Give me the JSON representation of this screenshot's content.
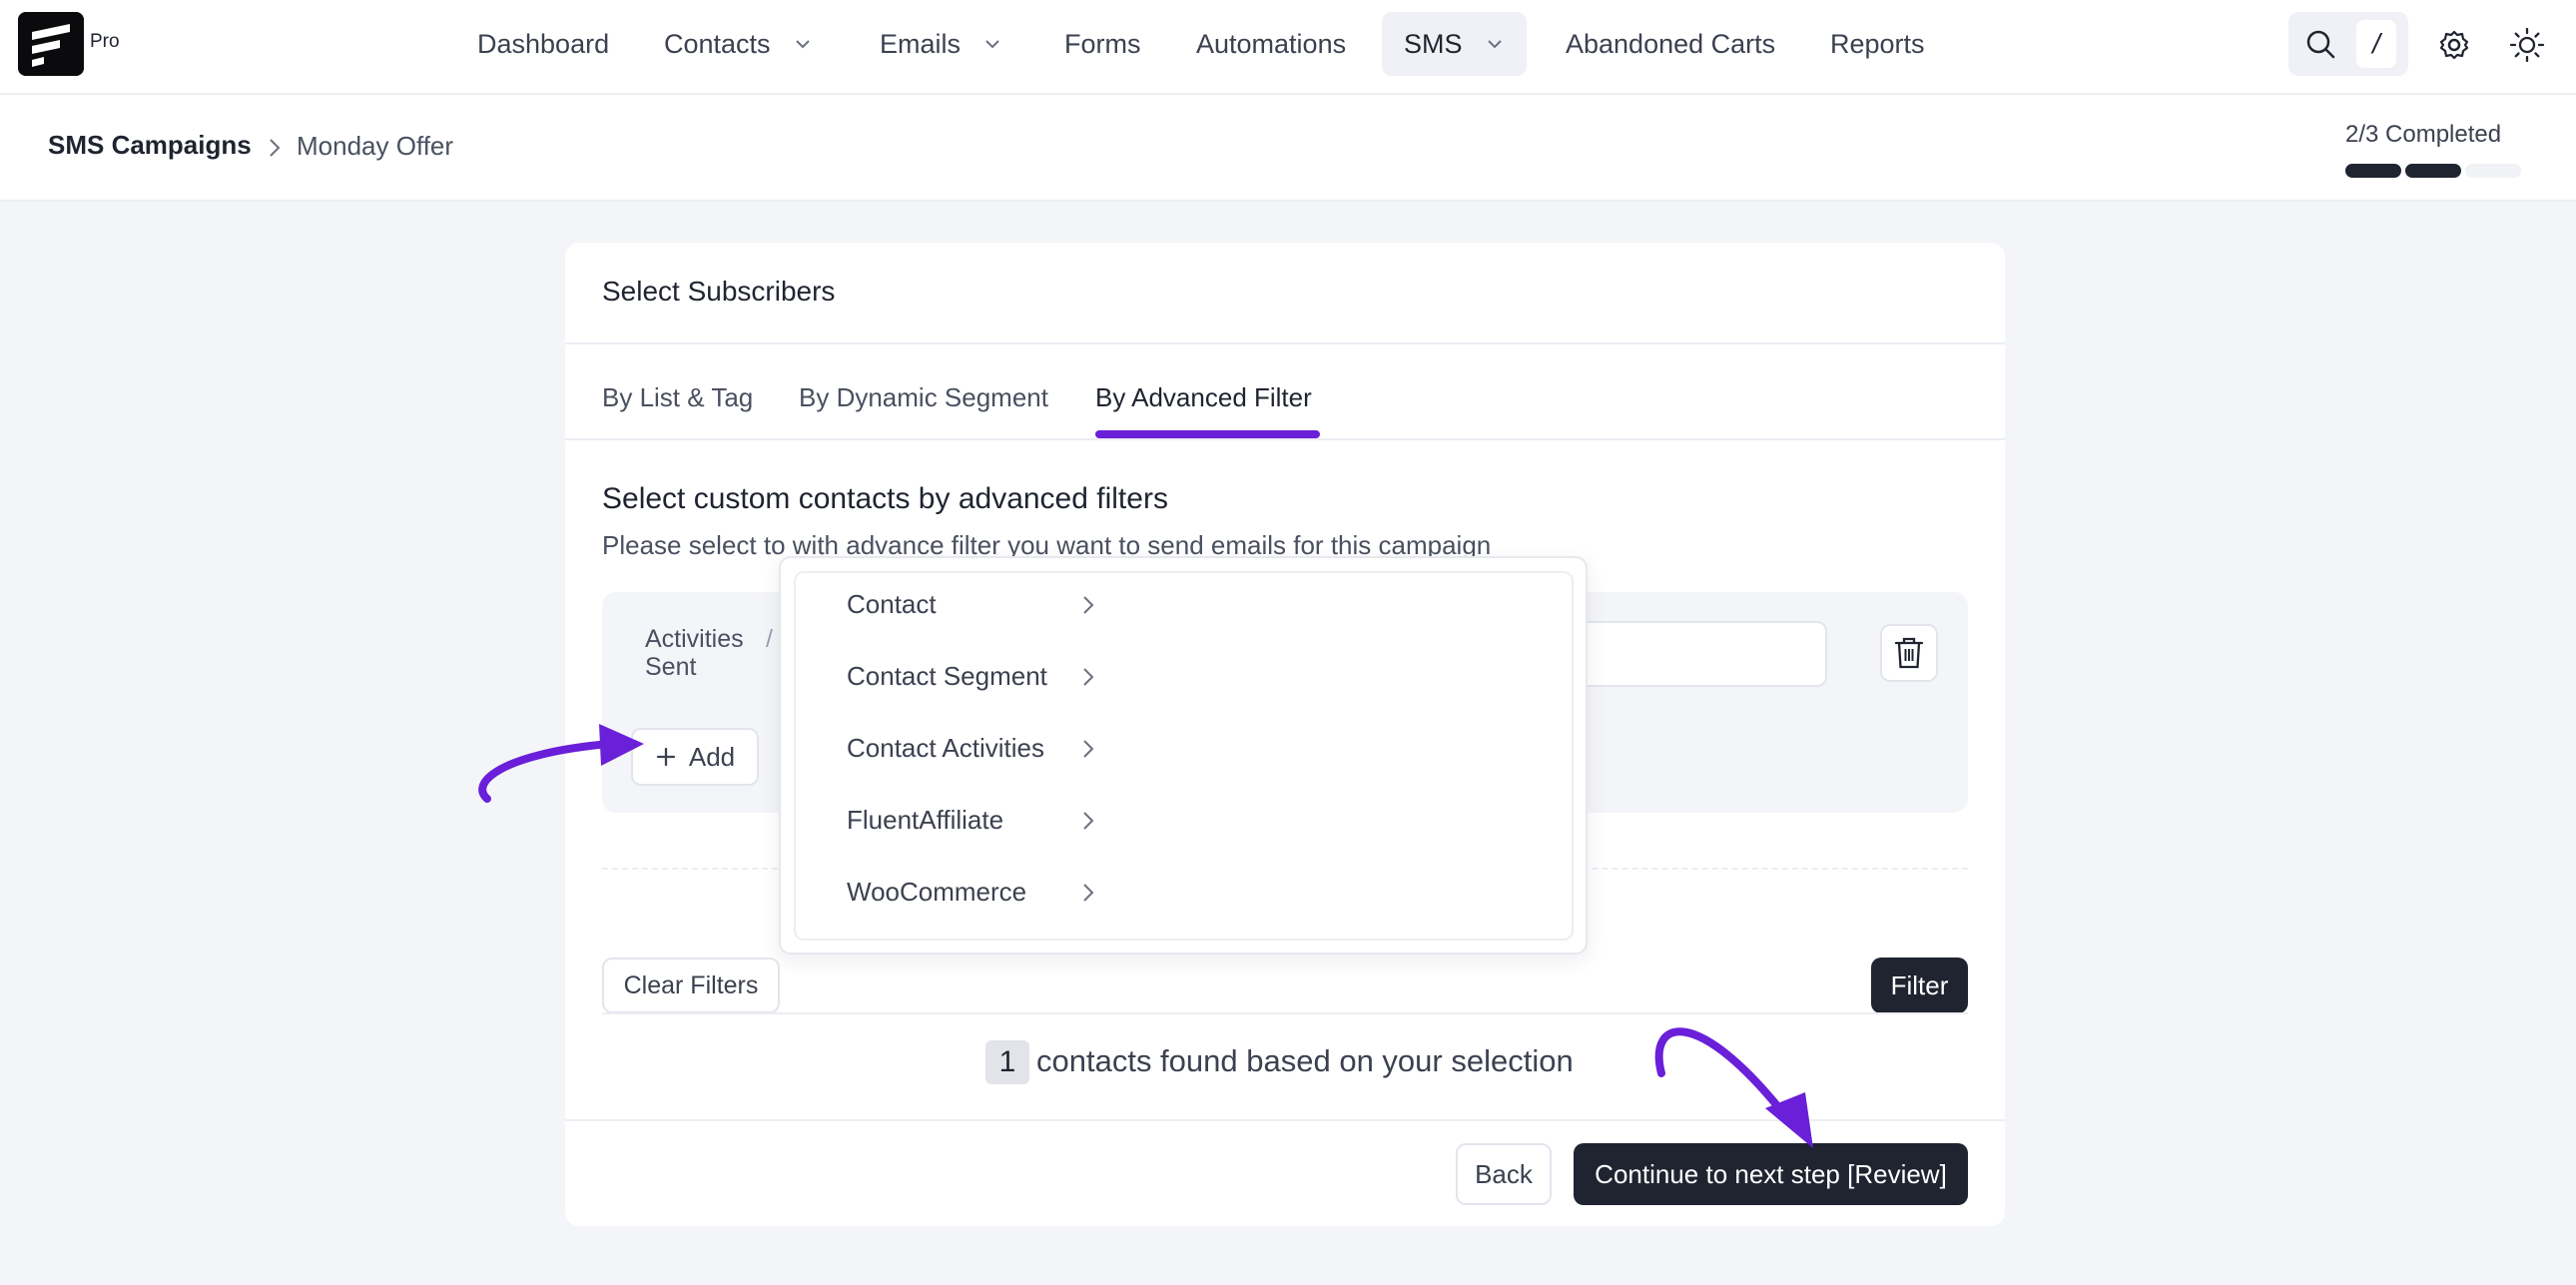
{
  "colors": {
    "accent": "#6a1fd9",
    "dark": "#1f2430",
    "background": "#f4f5f9"
  },
  "brand": {
    "badge": "Pro"
  },
  "nav": {
    "items": [
      {
        "label": "Dashboard"
      },
      {
        "label": "Contacts",
        "has_dropdown": true
      },
      {
        "label": "Emails",
        "has_dropdown": true
      },
      {
        "label": "Forms"
      },
      {
        "label": "Automations"
      },
      {
        "label": "SMS",
        "has_dropdown": true,
        "active": true
      },
      {
        "label": "Abandoned Carts"
      },
      {
        "label": "Reports"
      }
    ],
    "search_shortcut": "/",
    "icons": [
      "search-icon",
      "gear-icon",
      "sun-icon"
    ]
  },
  "breadcrumb": {
    "root": "SMS Campaigns",
    "current": "Monday Offer"
  },
  "progress": {
    "label": "2/3 Completed",
    "completed": 2,
    "total": 3
  },
  "card": {
    "title": "Select Subscribers",
    "tabs": [
      {
        "label": "By List & Tag"
      },
      {
        "label": "By Dynamic Segment"
      },
      {
        "label": "By Advanced Filter",
        "active": true
      }
    ],
    "section_title": "Select custom contacts by advanced filters",
    "section_desc": "Please select to with advance filter you want to send emails for this campaign",
    "filter_row": {
      "label_line1": "Activities",
      "label_line2": "Sent",
      "separator": "/"
    },
    "add_label": "Add",
    "dropdown_items": [
      {
        "label": "Contact"
      },
      {
        "label": "Contact Segment"
      },
      {
        "label": "Contact Activities"
      },
      {
        "label": "FluentAffiliate"
      },
      {
        "label": "WooCommerce"
      }
    ],
    "clear_label": "Clear Filters",
    "filter_label": "Filter",
    "count": "1",
    "count_text": "contacts found based on your selection",
    "back_label": "Back",
    "next_label": "Continue to next step [Review]"
  }
}
